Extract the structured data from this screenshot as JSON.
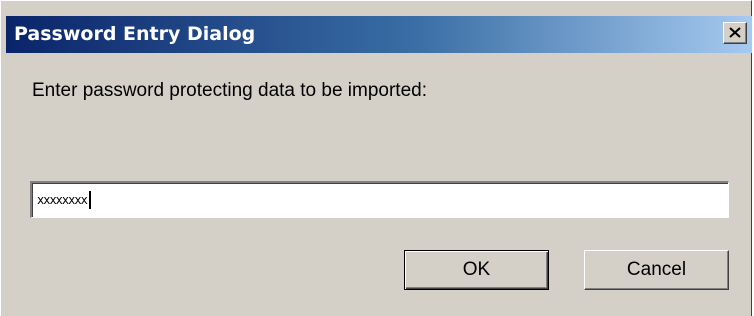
{
  "dialog": {
    "title": "Password Entry Dialog",
    "close_icon": "close-icon",
    "prompt": "Enter password protecting data to be imported:",
    "password_value": "xxxxxxxx",
    "ok_label": "OK",
    "cancel_label": "Cancel"
  },
  "colors": {
    "face": "#d4d0c8",
    "title_start": "#0a246a",
    "title_end": "#a6caf0"
  }
}
